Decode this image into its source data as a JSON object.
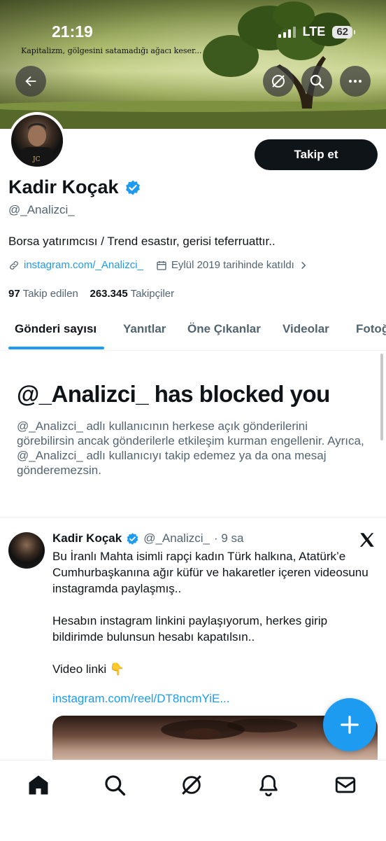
{
  "status_bar": {
    "time": "21:19",
    "network": "LTE",
    "battery": "62"
  },
  "banner": {
    "caption": "Kapitalizm, gölgesini satamadığı ağacı keser..."
  },
  "profile": {
    "name": "Kadir Koçak",
    "handle": "@_Analizci_",
    "bio": "Borsa yatırımcısı / Trend esastır, gerisi teferruattır..",
    "link": "instagram.com/_Analizci_",
    "joined": "Eylül 2019 tarihinde katıldı",
    "following_count": "97",
    "following_label": "Takip edilen",
    "followers_count": "263.345",
    "followers_label": "Takipçiler",
    "follow_button": "Takip et"
  },
  "tabs": [
    {
      "label": "Gönderi sayısı"
    },
    {
      "label": "Yanıtlar"
    },
    {
      "label": "Öne Çıkanlar"
    },
    {
      "label": "Videolar"
    },
    {
      "label": "Fotoğ"
    }
  ],
  "blocked": {
    "title": "@_Analizci_ has blocked you",
    "body": "@_Analizci_ adlı kullanıcının herkese açık gönderilerini görebilirsin ancak gönderilerle etkileşim kurman engellenir. Ayrıca, @_Analizci_ adlı kullanıcıyı takip edemez ya da ona mesaj gönderemezsin."
  },
  "tweet": {
    "author": "Kadir Koçak",
    "handle": "@_Analizci_",
    "time": "· 9 sa",
    "text": "Bu İranlı Mahta isimli rapçi kadın Türk halkına, Atatürk’e Cumhurbaşkanına ağır küfür ve hakaretler içeren videosunu instagramda paylaşmış..\n\nHesabın instagram linkini paylaşıyorum, herkes girip bildirimde bulunsun hesabı kapatılsın..\n\nVideo linki  👇",
    "link": "instagram.com/reel/DT8ncmYiE..."
  },
  "colors": {
    "accent": "#1d9bf0",
    "text": "#0f1419",
    "muted": "#536471"
  }
}
